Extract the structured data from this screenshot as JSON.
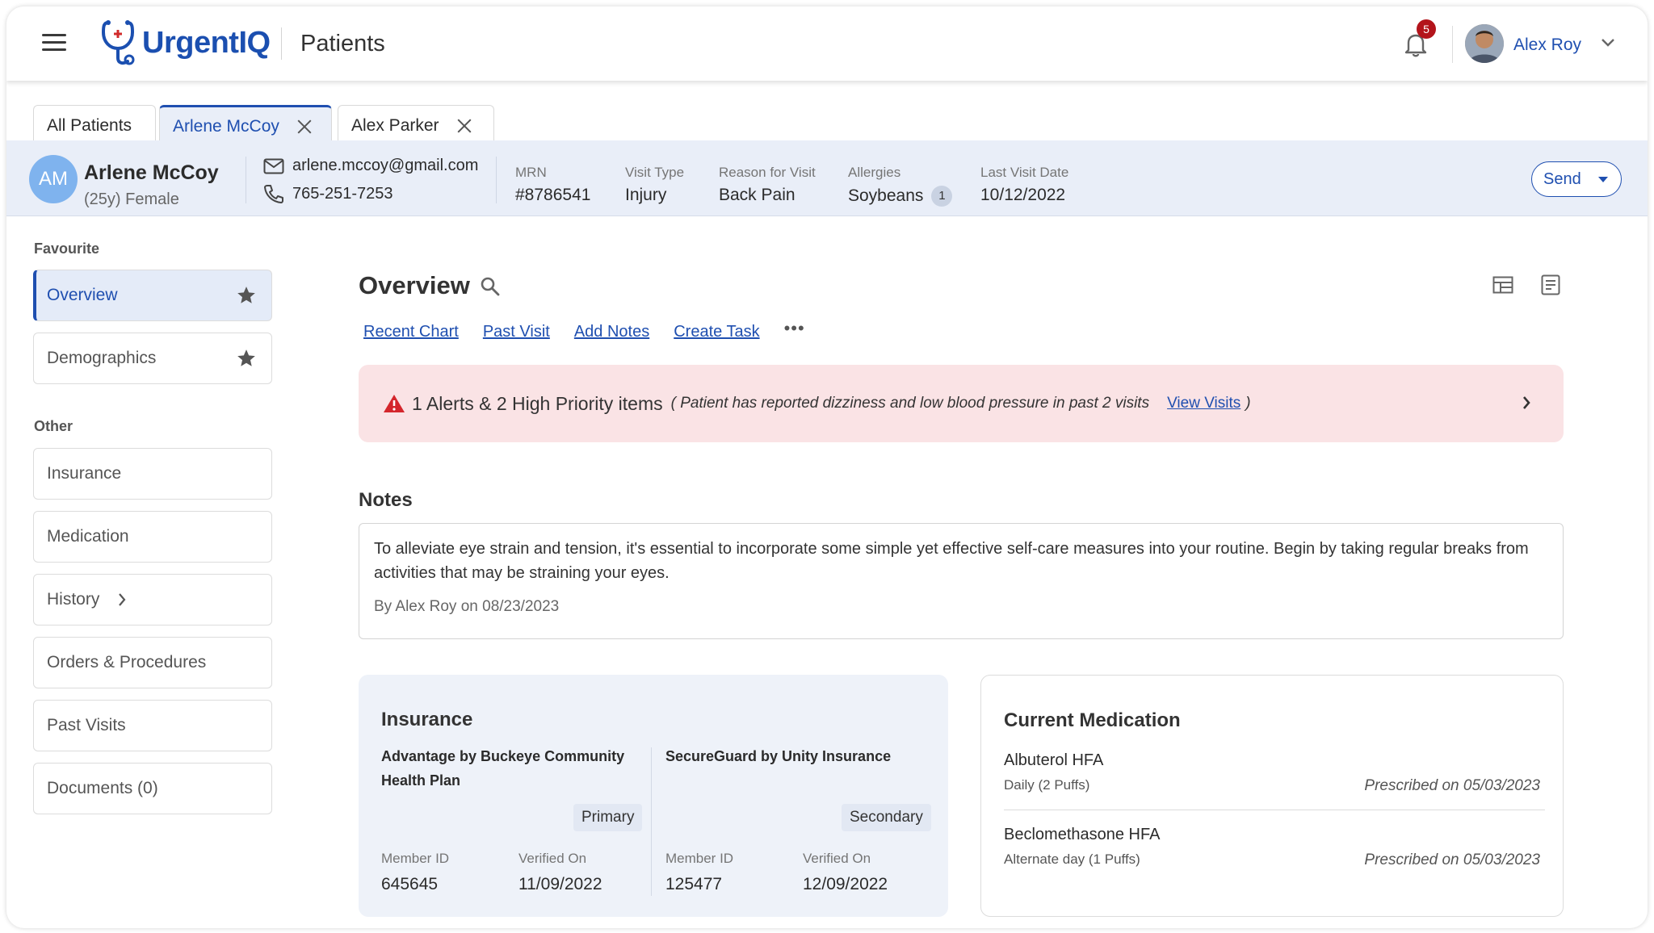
{
  "app": {
    "logo_text": "UrgentIQ",
    "page_title": "Patients"
  },
  "notifications": {
    "count": "5"
  },
  "user": {
    "name": "Alex Roy"
  },
  "patient_tabs": [
    {
      "label": "All Patients"
    },
    {
      "label": "Arlene McCoy"
    },
    {
      "label": "Alex Parker"
    }
  ],
  "patient": {
    "initials": "AM",
    "name": "Arlene McCoy",
    "age_gender": "(25y)  Female",
    "email": "arlene.mccoy@gmail.com",
    "phone": "765-251-7253",
    "mrn_label": "MRN",
    "mrn": "#8786541",
    "visit_type_label": "Visit Type",
    "visit_type": "Injury",
    "reason_label": "Reason for Visit",
    "reason": "Back Pain",
    "allergies_label": "Allergies",
    "allergies": "Soybeans",
    "allergies_count": "1",
    "last_visit_label": "Last Visit Date",
    "last_visit": "10/12/2022",
    "send_label": "Send"
  },
  "sidebar": {
    "favourite_heading": "Favourite",
    "favourites": [
      {
        "label": "Overview"
      },
      {
        "label": "Demographics"
      }
    ],
    "other_heading": "Other",
    "other": [
      {
        "label": "Insurance"
      },
      {
        "label": "Medication"
      },
      {
        "label": "History"
      },
      {
        "label": "Orders & Procedures"
      },
      {
        "label": "Past Visits"
      },
      {
        "label": "Documents (0)"
      }
    ]
  },
  "overview": {
    "title": "Overview",
    "links": [
      "Recent Chart",
      "Past Visit",
      "Add Notes",
      "Create Task"
    ],
    "more": "•••"
  },
  "alert": {
    "title": "1 Alerts & 2 High Priority items",
    "description": "( Patient has reported dizziness and low blood pressure in past 2 visits",
    "link": "View Visits",
    "close": ")",
    "color": "#fae3e5"
  },
  "notes": {
    "heading": "Notes",
    "text": "To alleviate eye strain and tension, it's essential to incorporate some simple yet effective self-care measures into your routine. Begin by taking regular breaks from activities that may be straining your eyes.",
    "by": "By Alex Roy on 08/23/2023"
  },
  "insurance": {
    "heading": "Insurance",
    "plans": [
      {
        "name": "Advantage by Buckeye Community Health Plan",
        "tag": "Primary",
        "member_id_label": "Member ID",
        "member_id": "645645",
        "verified_label": "Verified On",
        "verified_on": "11/09/2022"
      },
      {
        "name": "SecureGuard by Unity Insurance",
        "tag": "Secondary",
        "member_id_label": "Member ID",
        "member_id": "125477",
        "verified_label": "Verified On",
        "verified_on": "12/09/2022"
      }
    ]
  },
  "medication": {
    "heading": "Current Medication",
    "items": [
      {
        "name": "Albuterol HFA",
        "dose": "Daily (2 Puffs)",
        "prescribed": "Prescribed on 05/03/2023"
      },
      {
        "name": "Beclomethasone HFA",
        "dose": "Alternate day  (1 Puffs)",
        "prescribed": "Prescribed on 05/03/2023"
      }
    ]
  },
  "colors": {
    "primary": "#1f4fb0",
    "header_bg": "#e9eef8",
    "alert_bg": "#fae3e5",
    "badge": "#b3141b"
  }
}
